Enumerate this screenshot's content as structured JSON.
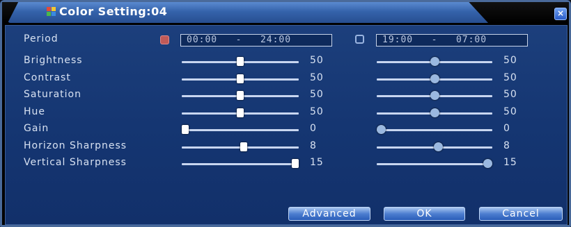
{
  "window": {
    "title": "Color Setting:04",
    "close_label": "×"
  },
  "period": {
    "label": "Period",
    "range1": {
      "checked": true,
      "start": "00:00",
      "end": "24:00"
    },
    "range2": {
      "checked": false,
      "start": "19:00",
      "end": "07:00"
    }
  },
  "rows": [
    {
      "label": "Brightness",
      "v1": "50",
      "v2": "50",
      "max": 100
    },
    {
      "label": "Contrast",
      "v1": "50",
      "v2": "50",
      "max": 100
    },
    {
      "label": "Saturation",
      "v1": "50",
      "v2": "50",
      "max": 100
    },
    {
      "label": "Hue",
      "v1": "50",
      "v2": "50",
      "max": 100
    },
    {
      "label": "Gain",
      "v1": "0",
      "v2": "0",
      "max": 100
    },
    {
      "label": "Horizon Sharpness",
      "v1": "8",
      "v2": "8",
      "max": 15
    },
    {
      "label": "Vertical Sharpness",
      "v1": "15",
      "v2": "15",
      "max": 15
    }
  ],
  "buttons": {
    "advanced": "Advanced",
    "ok": "OK",
    "cancel": "Cancel"
  },
  "colors": {
    "accent": "#3563ab",
    "panel": "#153672",
    "checked": "#c05a58"
  }
}
